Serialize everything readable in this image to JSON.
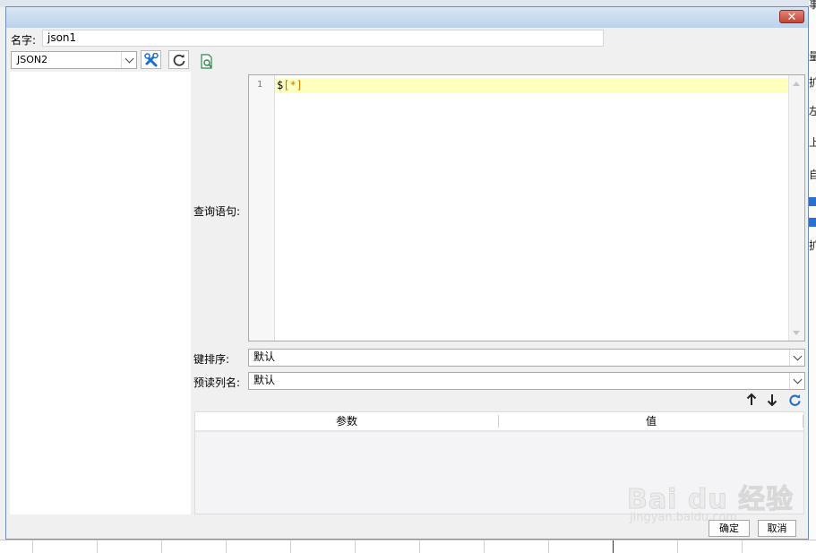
{
  "dialog": {
    "close_label": "✕",
    "name_label": "名字:",
    "name_value": "json1",
    "datasource_value": "JSON2"
  },
  "editor": {
    "query_label": "查询语句:",
    "line_number": "1",
    "code_prefix": "$",
    "code_brackets": "[*]"
  },
  "key_sort": {
    "label": "键排序:",
    "value": "默认"
  },
  "preread": {
    "label": "预读列名:",
    "value": "默认"
  },
  "params_table": {
    "columns": [
      "参数",
      "值"
    ]
  },
  "footer": {
    "ok_label": "确定",
    "cancel_label": "取消"
  },
  "background": {
    "right_fragments": [
      "事",
      "量",
      "扩",
      "左",
      "上",
      "自",
      "扩"
    ]
  },
  "watermark": {
    "main": "Bai du 经验",
    "sub": "jingyan.baidu.com"
  },
  "colors": {
    "accent_blue": "#1f6fc9",
    "highlight_line": "#ffffbe",
    "close_red": "#c34532",
    "title_gradient_top": "#d9e6f5"
  },
  "icons": {
    "tools": "tools-icon",
    "refresh": "refresh-icon",
    "preview": "preview-icon",
    "move_up": "arrow-up-icon",
    "move_down": "arrow-down-icon",
    "reload": "reload-icon"
  }
}
